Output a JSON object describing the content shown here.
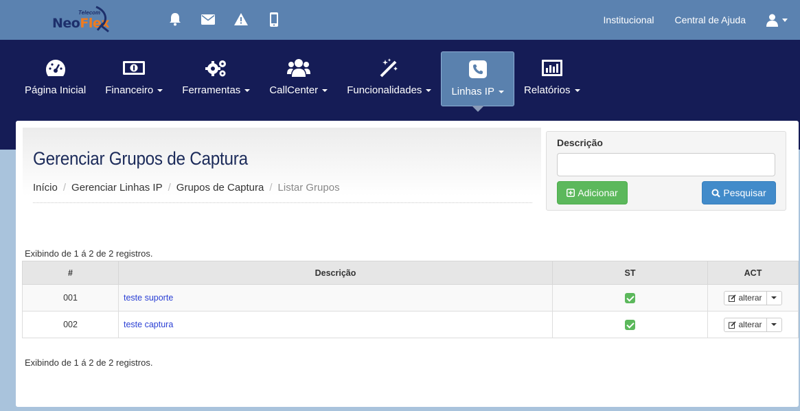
{
  "header": {
    "logo": {
      "brand_neo": "Neo",
      "brand_flex": "Flex",
      "tagline": "Telecom"
    },
    "icons": [
      "bell-icon",
      "envelope-icon",
      "warning-icon",
      "mobile-icon"
    ],
    "links": {
      "institucional": "Institucional",
      "help": "Central de Ajuda"
    },
    "user_icon": "user-icon"
  },
  "nav": {
    "items": [
      {
        "label": "Página Inicial",
        "icon": "dashboard-icon",
        "dropdown": false
      },
      {
        "label": "Financeiro",
        "icon": "money-icon",
        "dropdown": true
      },
      {
        "label": "Ferramentas",
        "icon": "gears-icon",
        "dropdown": true
      },
      {
        "label": "CallCenter",
        "icon": "users-icon",
        "dropdown": true
      },
      {
        "label": "Funcionalidades",
        "icon": "magic-wand-icon",
        "dropdown": true
      },
      {
        "label": "Linhas IP",
        "icon": "phone-icon",
        "dropdown": true,
        "active": true
      },
      {
        "label": "Relatórios",
        "icon": "bar-chart-icon",
        "dropdown": true
      }
    ]
  },
  "page": {
    "title": "Gerenciar Grupos de Captura",
    "breadcrumb": [
      "Início",
      "Gerenciar Linhas IP",
      "Grupos de Captura",
      "Listar Grupos"
    ]
  },
  "search": {
    "label": "Descrição",
    "value": "",
    "placeholder": "",
    "add_label": "Adicionar",
    "search_label": "Pesquisar"
  },
  "table": {
    "count_text": "Exibindo de 1 á 2 de 2 registros.",
    "headers": [
      "#",
      "Descrição",
      "ST",
      "ACT"
    ],
    "rows": [
      {
        "num": "001",
        "desc": "teste suporte",
        "status": "active",
        "action": "alterar"
      },
      {
        "num": "002",
        "desc": "teste captura",
        "status": "active",
        "action": "alterar"
      }
    ]
  },
  "colors": {
    "topbar": "#5b82b0",
    "navbar": "#151c56",
    "active_nav": "#5a81ae",
    "success": "#5cb85c",
    "primary": "#428bca",
    "link": "#2a3fd4"
  }
}
